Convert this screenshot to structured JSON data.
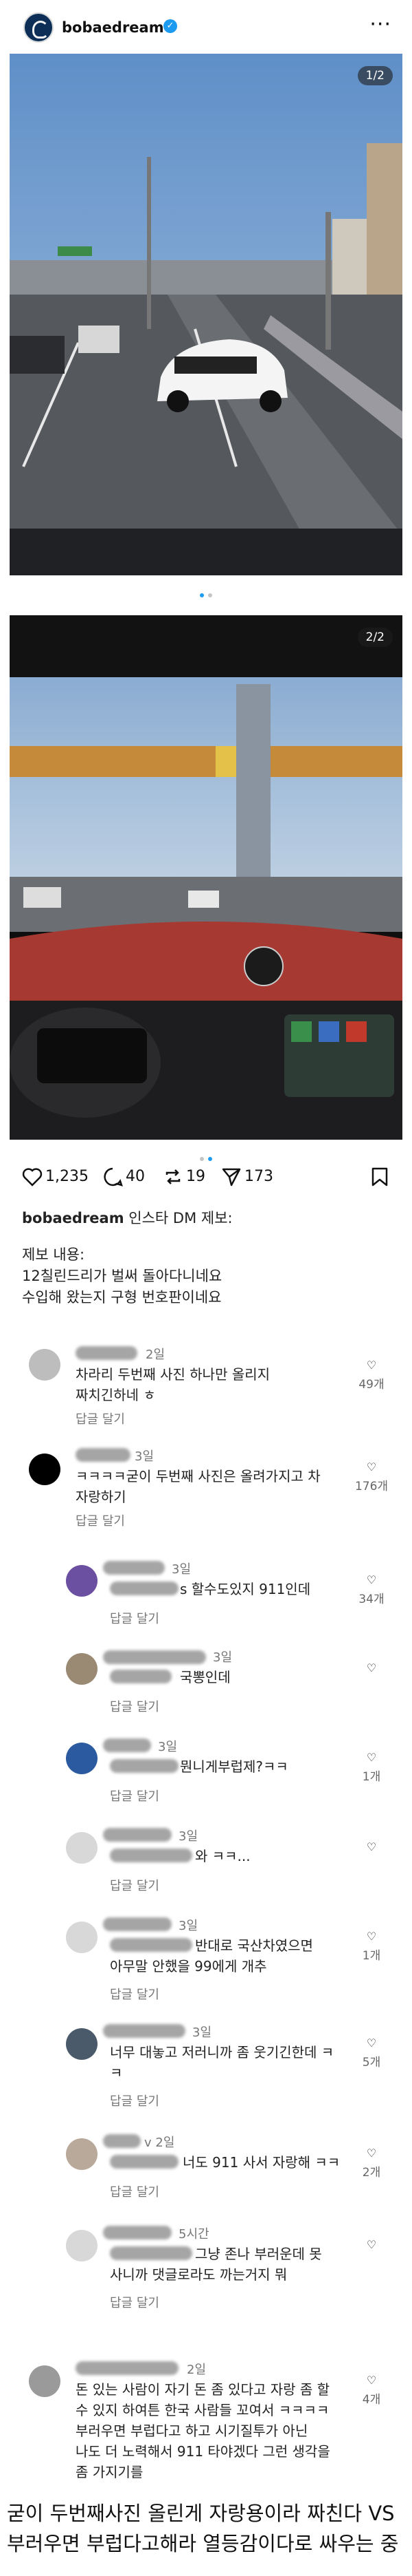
{
  "header": {
    "username": "bobaedream",
    "verified_mark": "✓",
    "more_icon": "···"
  },
  "photos": [
    {
      "counter": "1/2"
    },
    {
      "counter": "2/2"
    }
  ],
  "actions": {
    "likes": "1,235",
    "comments": "40",
    "reposts": "19",
    "shares": "173"
  },
  "caption": {
    "username": "bobaedream",
    "title": "인스타 DM 제보:",
    "body": "제보 내용:\n12칠린드리가 벌써 돌아다니네요\n수입해 왔는지 구형 번호판이네요"
  },
  "comments": [
    {
      "time": "2일",
      "text": "차라리 두번째 사진 하나만 올리지\n짜치긴하네 ㅎ",
      "reply": "답글 달기",
      "likes": "49개"
    },
    {
      "time": "3일",
      "text": "ㅋㅋㅋㅋ굳이 두번째 사진은 올려가지고 차\n자랑하기",
      "reply": "답글 달기",
      "likes": "176개"
    },
    {
      "time": "3일",
      "text": "s 할수도있지 911인데",
      "reply": "답글 달기",
      "likes": "34개"
    },
    {
      "time": "3일",
      "text": "국뽕인데",
      "reply": "답글 달기",
      "likes": ""
    },
    {
      "time": "3일",
      "text": "뭔니게부럽제?ㅋㅋ",
      "reply": "답글 달기",
      "likes": "1개"
    },
    {
      "time": "3일",
      "text": "와 ㅋㅋ...",
      "reply": "답글 달기",
      "likes": ""
    },
    {
      "time": "3일",
      "text": "반대로 국산차였으면\n아무말 안했을 99에게 개추",
      "reply": "답글 달기",
      "likes": "1개"
    },
    {
      "time": "3일",
      "text": "너무 대놓고 저러니까 좀 웃기긴한데 ㅋ\nㅋ",
      "reply": "답글 달기",
      "likes": "5개"
    },
    {
      "time": "v 2일",
      "text": "너도 911 사서 자랑해 ㅋㅋ",
      "reply": "답글 달기",
      "likes": "2개"
    },
    {
      "time": "5시간",
      "text": "그냥 존나 부러운데 못\n사니까 댓글로라도 까는거지 뭐",
      "reply": "답글 달기",
      "likes": ""
    },
    {
      "time": "2일",
      "text": "돈 있는 사람이 자기 돈 좀 있다고 자랑 좀 할\n수 있지 하여튼 한국 사람들 꼬여서 ㅋㅋㅋㅋ\n부러우면 부럽다고 하고 시기질투가 아닌\n나도 더 노력해서 911 타야겠다 그런 생각을\n좀 가지기를",
      "reply": "답글 달기",
      "likes": "4개"
    }
  ],
  "bottom_text": "굳이 두번째사진 올린게 자랑용이라 짜친다 VS\n부러우면 부럽다고해라 열등감이다로 싸우는 중"
}
